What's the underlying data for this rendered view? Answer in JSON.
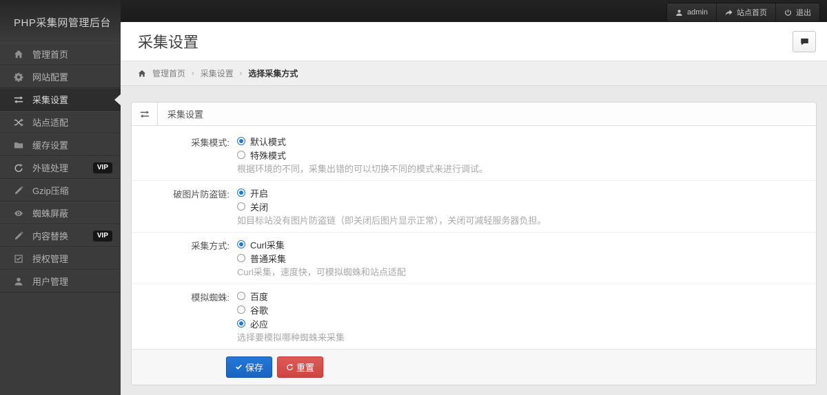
{
  "brand": {
    "title": "PHP采集网管理后台"
  },
  "topbar": {
    "user_label": "admin",
    "site_home_label": "站点首页",
    "logout_label": "退出"
  },
  "sidebar": {
    "vip_label": "VIP",
    "items": [
      {
        "label": "管理首页",
        "icon": "home-icon",
        "active": false,
        "vip": false
      },
      {
        "label": "网站配置",
        "icon": "gear-icon",
        "active": false,
        "vip": false
      },
      {
        "label": "采集设置",
        "icon": "repeat-icon",
        "active": true,
        "vip": false
      },
      {
        "label": "站点适配",
        "icon": "shuffle-icon",
        "active": false,
        "vip": false
      },
      {
        "label": "缓存设置",
        "icon": "folder-icon",
        "active": false,
        "vip": false
      },
      {
        "label": "外链处理",
        "icon": "refresh-icon",
        "active": false,
        "vip": true
      },
      {
        "label": "Gzip压缩",
        "icon": "pencil-icon",
        "active": false,
        "vip": false
      },
      {
        "label": "蜘蛛屏蔽",
        "icon": "eye-icon",
        "active": false,
        "vip": false
      },
      {
        "label": "内容替换",
        "icon": "pencil-icon",
        "active": false,
        "vip": true
      },
      {
        "label": "授权管理",
        "icon": "check-square-icon",
        "active": false,
        "vip": false
      },
      {
        "label": "用户管理",
        "icon": "user-icon",
        "active": false,
        "vip": false
      }
    ]
  },
  "header": {
    "title": "采集设置"
  },
  "breadcrumb": {
    "separator": "›",
    "items": [
      "管理首页",
      "采集设置",
      "选择采集方式"
    ]
  },
  "panel": {
    "title": "采集设置",
    "groups": [
      {
        "label": "采集模式:",
        "options": [
          {
            "text": "默认模式",
            "checked": true
          },
          {
            "text": "特殊模式",
            "checked": false
          }
        ],
        "help": "根据环境的不同，采集出错的可以切换不同的模式来进行调试。"
      },
      {
        "label": "破图片防盗链:",
        "options": [
          {
            "text": "开启",
            "checked": true
          },
          {
            "text": "关闭",
            "checked": false
          }
        ],
        "help": "如目标站没有图片防盗链（即关闭后图片显示正常），关闭可减轻服务器负担。"
      },
      {
        "label": "采集方式:",
        "options": [
          {
            "text": "Curl采集",
            "checked": true
          },
          {
            "text": "普通采集",
            "checked": false
          }
        ],
        "help": "Curl采集，速度快，可模拟蜘蛛和站点适配"
      },
      {
        "label": "模拟蜘蛛:",
        "options": [
          {
            "text": "百度",
            "checked": false
          },
          {
            "text": "谷歌",
            "checked": false
          },
          {
            "text": "必应",
            "checked": true
          }
        ],
        "help": "选择要模拟哪种蜘蛛来采集"
      }
    ],
    "save_label": "保存",
    "reset_label": "重置"
  },
  "colors": {
    "accent_blue": "#2077d4",
    "danger_red": "#d9534f",
    "topbar_bg": "#1d1d1d",
    "sidebar_bg": "#3b3b3b",
    "content_bg": "#e9e9e9",
    "vip_badge_bg": "#161616"
  },
  "icons": {
    "home-icon": "house",
    "gear-icon": "cog",
    "repeat-icon": "two opposing arrows",
    "shuffle-icon": "crossing arrows",
    "folder-icon": "folder",
    "refresh-icon": "circular arrow",
    "pencil-icon": "pencil",
    "eye-icon": "eye",
    "check-square-icon": "checked square",
    "user-icon": "person silhouette",
    "share-icon": "forward arrow",
    "power-icon": "power symbol",
    "comment-icon": "speech bubble",
    "check-icon": "check mark"
  }
}
